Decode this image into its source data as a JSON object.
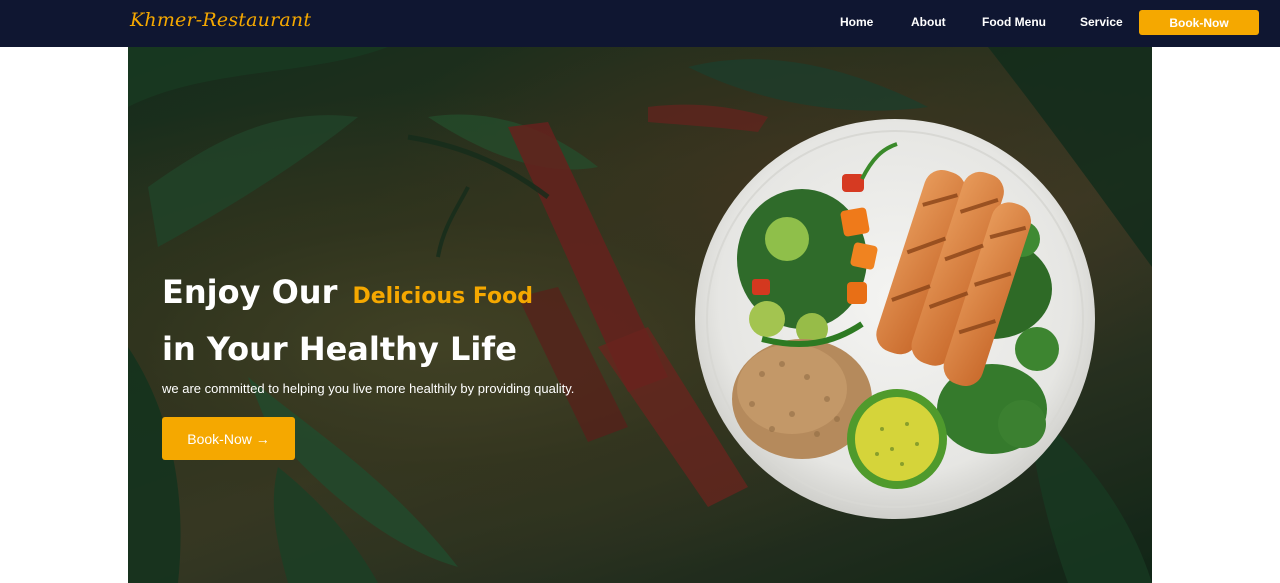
{
  "brand": {
    "logo_text": "Khmer-Restaurant"
  },
  "nav": {
    "links": [
      "Home",
      "About",
      "Food Menu",
      "Service"
    ],
    "cta_label": "Book-Now"
  },
  "hero": {
    "headline_prefix": "Enjoy Our",
    "headline_accent": "Delicious Food",
    "headline_line2": "in Your Healthy Life",
    "subtitle": "we are committed to helping you live more healthily by providing quality.",
    "cta_label": "Book-Now →"
  },
  "colors": {
    "navbar": "#0f1631",
    "accent": "#f5a800",
    "text": "#ffffff"
  }
}
